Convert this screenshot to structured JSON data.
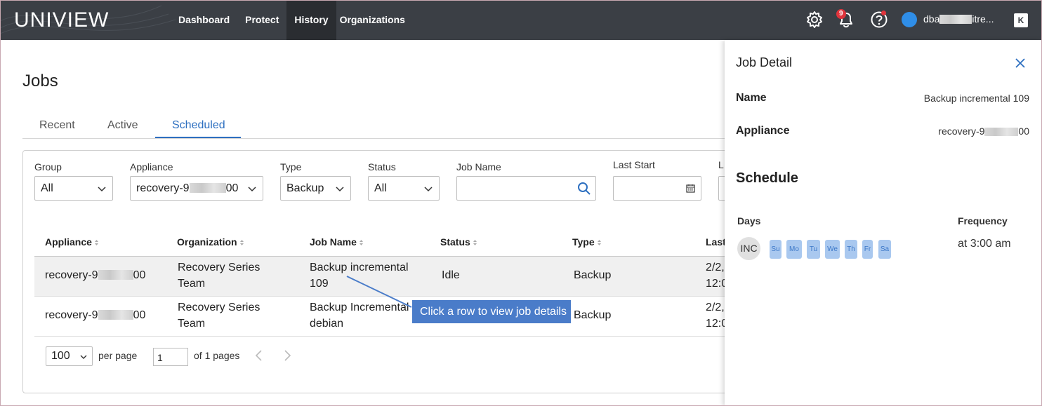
{
  "topnav": {
    "logo": "UNIVIEW",
    "items": [
      {
        "label": "Dashboard",
        "active": false
      },
      {
        "label": "Protect",
        "active": false
      },
      {
        "label": "History",
        "active": true
      },
      {
        "label": "Organizations",
        "active": false
      }
    ],
    "notification_count": "9",
    "user_name_start": "dba",
    "user_name_end": "itre..."
  },
  "page": {
    "title": "Jobs",
    "tabs": [
      {
        "label": "Recent",
        "active": false
      },
      {
        "label": "Active",
        "active": false
      },
      {
        "label": "Scheduled",
        "active": true
      }
    ]
  },
  "filters": {
    "group": {
      "label": "Group",
      "value": "All"
    },
    "appliance": {
      "label": "Appliance",
      "value_start": "recovery-9",
      "value_end": "00"
    },
    "type": {
      "label": "Type",
      "value": "Backup"
    },
    "status": {
      "label": "Status",
      "value": "All"
    },
    "job_name": {
      "label": "Job Name",
      "value": ""
    },
    "last_start": {
      "label": "Last Start",
      "value": ""
    },
    "last_end": {
      "label": "L"
    }
  },
  "table": {
    "columns": [
      "Appliance",
      "Organization",
      "Job Name",
      "Status",
      "Type",
      "Last"
    ],
    "rows": [
      {
        "appliance_start": "recovery-9",
        "appliance_end": "00",
        "organization": [
          "Recovery Series",
          "Team"
        ],
        "job_name": [
          "Backup incremental",
          "109"
        ],
        "status": "Idle",
        "type": "Backup",
        "last": [
          "2/2,",
          "12:0"
        ]
      },
      {
        "appliance_start": "recovery-9",
        "appliance_end": "00",
        "organization": [
          "Recovery Series",
          "Team"
        ],
        "job_name": [
          "Backup Incremental",
          "debian"
        ],
        "status": "",
        "type": "Backup",
        "last": [
          "2/2,",
          "12:0"
        ]
      }
    ]
  },
  "pagination": {
    "per_page_value": "100",
    "per_page_label": "per page",
    "current_page": "1",
    "of_pages": "of 1 pages"
  },
  "callout": {
    "text": "Click a row to view job details"
  },
  "drawer": {
    "title": "Job Detail",
    "name_label": "Name",
    "name_value": "Backup incremental 109",
    "appliance_label": "Appliance",
    "appliance_value_start": "recovery-9",
    "appliance_value_end": "00",
    "schedule_title": "Schedule",
    "days_label": "Days",
    "frequency_label": "Frequency",
    "inc_label": "INC",
    "days": [
      "Su",
      "Mo",
      "Tu",
      "We",
      "Th",
      "Fr",
      "Sa"
    ],
    "frequency_value": "at 3:00 am"
  },
  "colors": {
    "topbar": "#3b3f45",
    "accent": "#2d6fc0",
    "callout": "#4a7cc9",
    "day_chip": "#a9c8ef",
    "badge": "#e0343c"
  }
}
